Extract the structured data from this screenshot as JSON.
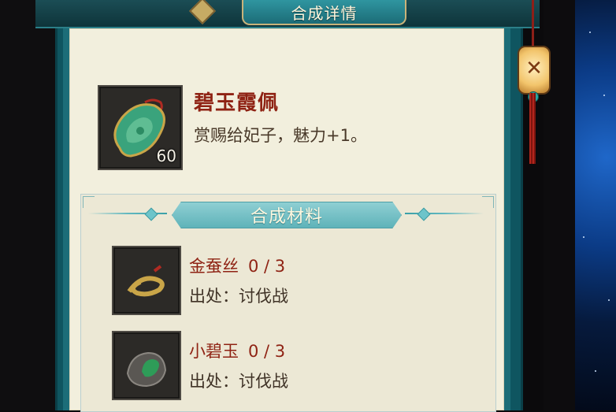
{
  "window": {
    "title": "合成详情"
  },
  "item": {
    "name": "碧玉霞佩",
    "description": "赏赐给妃子，魅力+1。",
    "quantity": "60",
    "icon": "jade-pendant-icon"
  },
  "materials_section": {
    "title": "合成材料",
    "materials": [
      {
        "name": "金蚕丝",
        "count": "0 / 3",
        "source": "出处：讨伐战",
        "icon": "gold-silk-icon"
      },
      {
        "name": "小碧玉",
        "count": "0 / 3",
        "source": "出处：讨伐战",
        "icon": "small-jade-icon"
      }
    ]
  },
  "decor": {
    "lantern_icon": "lantern-icon"
  },
  "colors": {
    "accent_teal": "#1c6d78",
    "panel_bg": "#f2efdd",
    "name_red": "#8f2314",
    "title_gold": "#c9b37a"
  }
}
